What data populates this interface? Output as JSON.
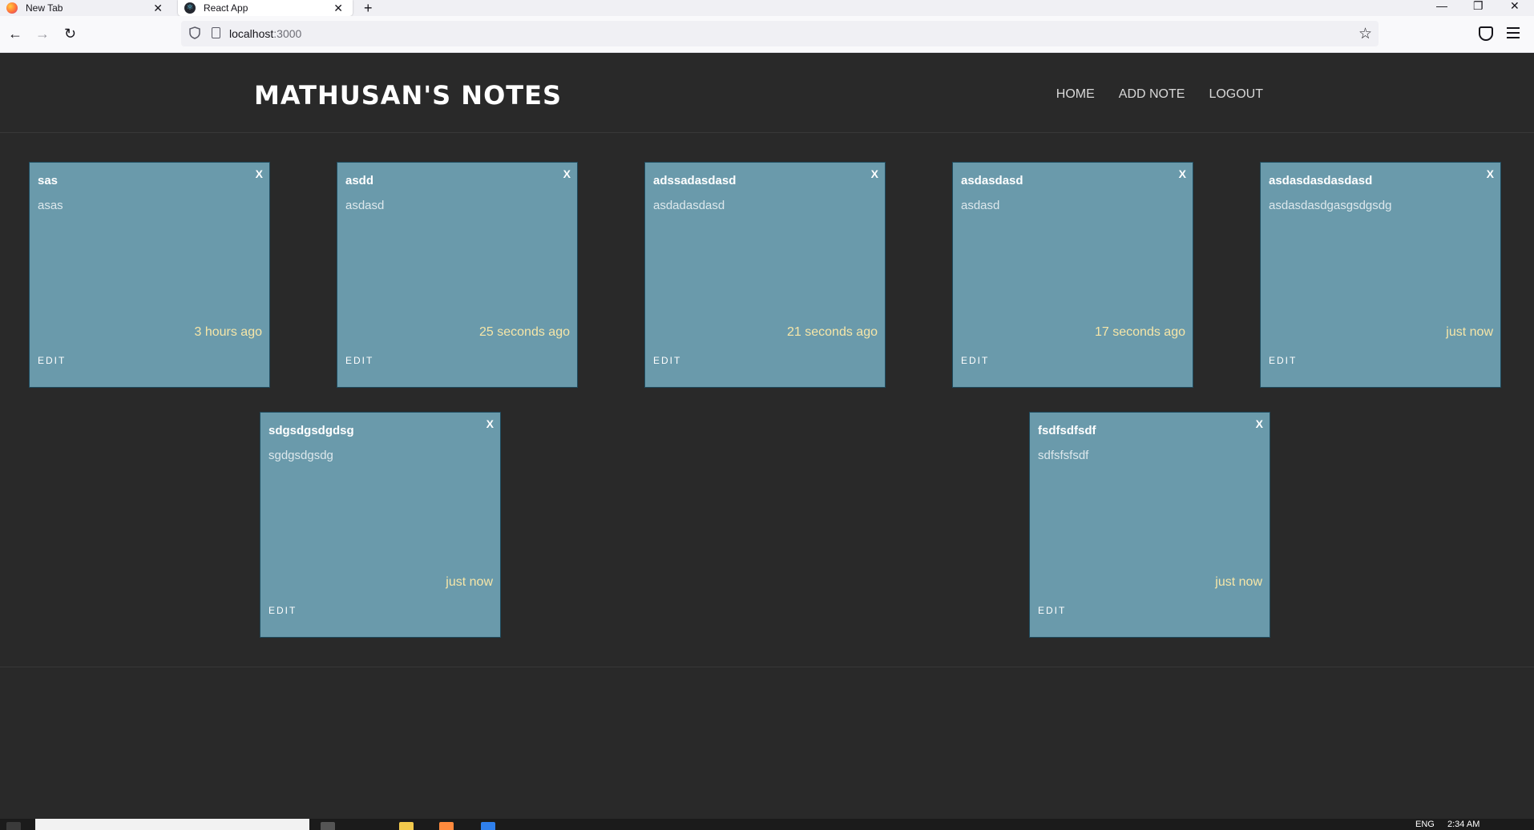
{
  "browser": {
    "tabs": [
      {
        "label": "New Tab",
        "active": false,
        "icon": "firefox-icon"
      },
      {
        "label": "React App",
        "active": true,
        "icon": "react-icon"
      }
    ],
    "url": {
      "host": "localhost",
      "port": ":3000"
    }
  },
  "app": {
    "brand": "MATHUSAN'S NOTES",
    "menu": [
      "HOME",
      "ADD NOTE",
      "LOGOUT"
    ],
    "accent_color": "#6a9aab",
    "time_color": "#f6e6a8"
  },
  "notes": [
    {
      "title": "sas",
      "content": "asas",
      "time": "3 hours ago",
      "close_label": "X",
      "edit_label": "EDIT"
    },
    {
      "title": "asdd",
      "content": "asdasd",
      "time": "25 seconds ago",
      "close_label": "X",
      "edit_label": "EDIT"
    },
    {
      "title": "adssadasdasd",
      "content": "asdadasdasd",
      "time": "21 seconds ago",
      "close_label": "X",
      "edit_label": "EDIT"
    },
    {
      "title": "asdasdasd",
      "content": "asdasd",
      "time": "17 seconds ago",
      "close_label": "X",
      "edit_label": "EDIT"
    },
    {
      "title": "asdasdasdasdasd",
      "content": "asdasdasdgasgsdgsdg",
      "time": "just now",
      "close_label": "X",
      "edit_label": "EDIT"
    },
    {
      "title": "sdgsdgsdgdsg",
      "content": "sgdgsdgsdg",
      "time": "just now",
      "close_label": "X",
      "edit_label": "EDIT"
    },
    {
      "title": "fsdfsdfsdf",
      "content": "sdfsfsfsdf",
      "time": "just now",
      "close_label": "X",
      "edit_label": "EDIT"
    }
  ],
  "taskbar": {
    "language": "ENG",
    "clock": "2:34 AM"
  }
}
